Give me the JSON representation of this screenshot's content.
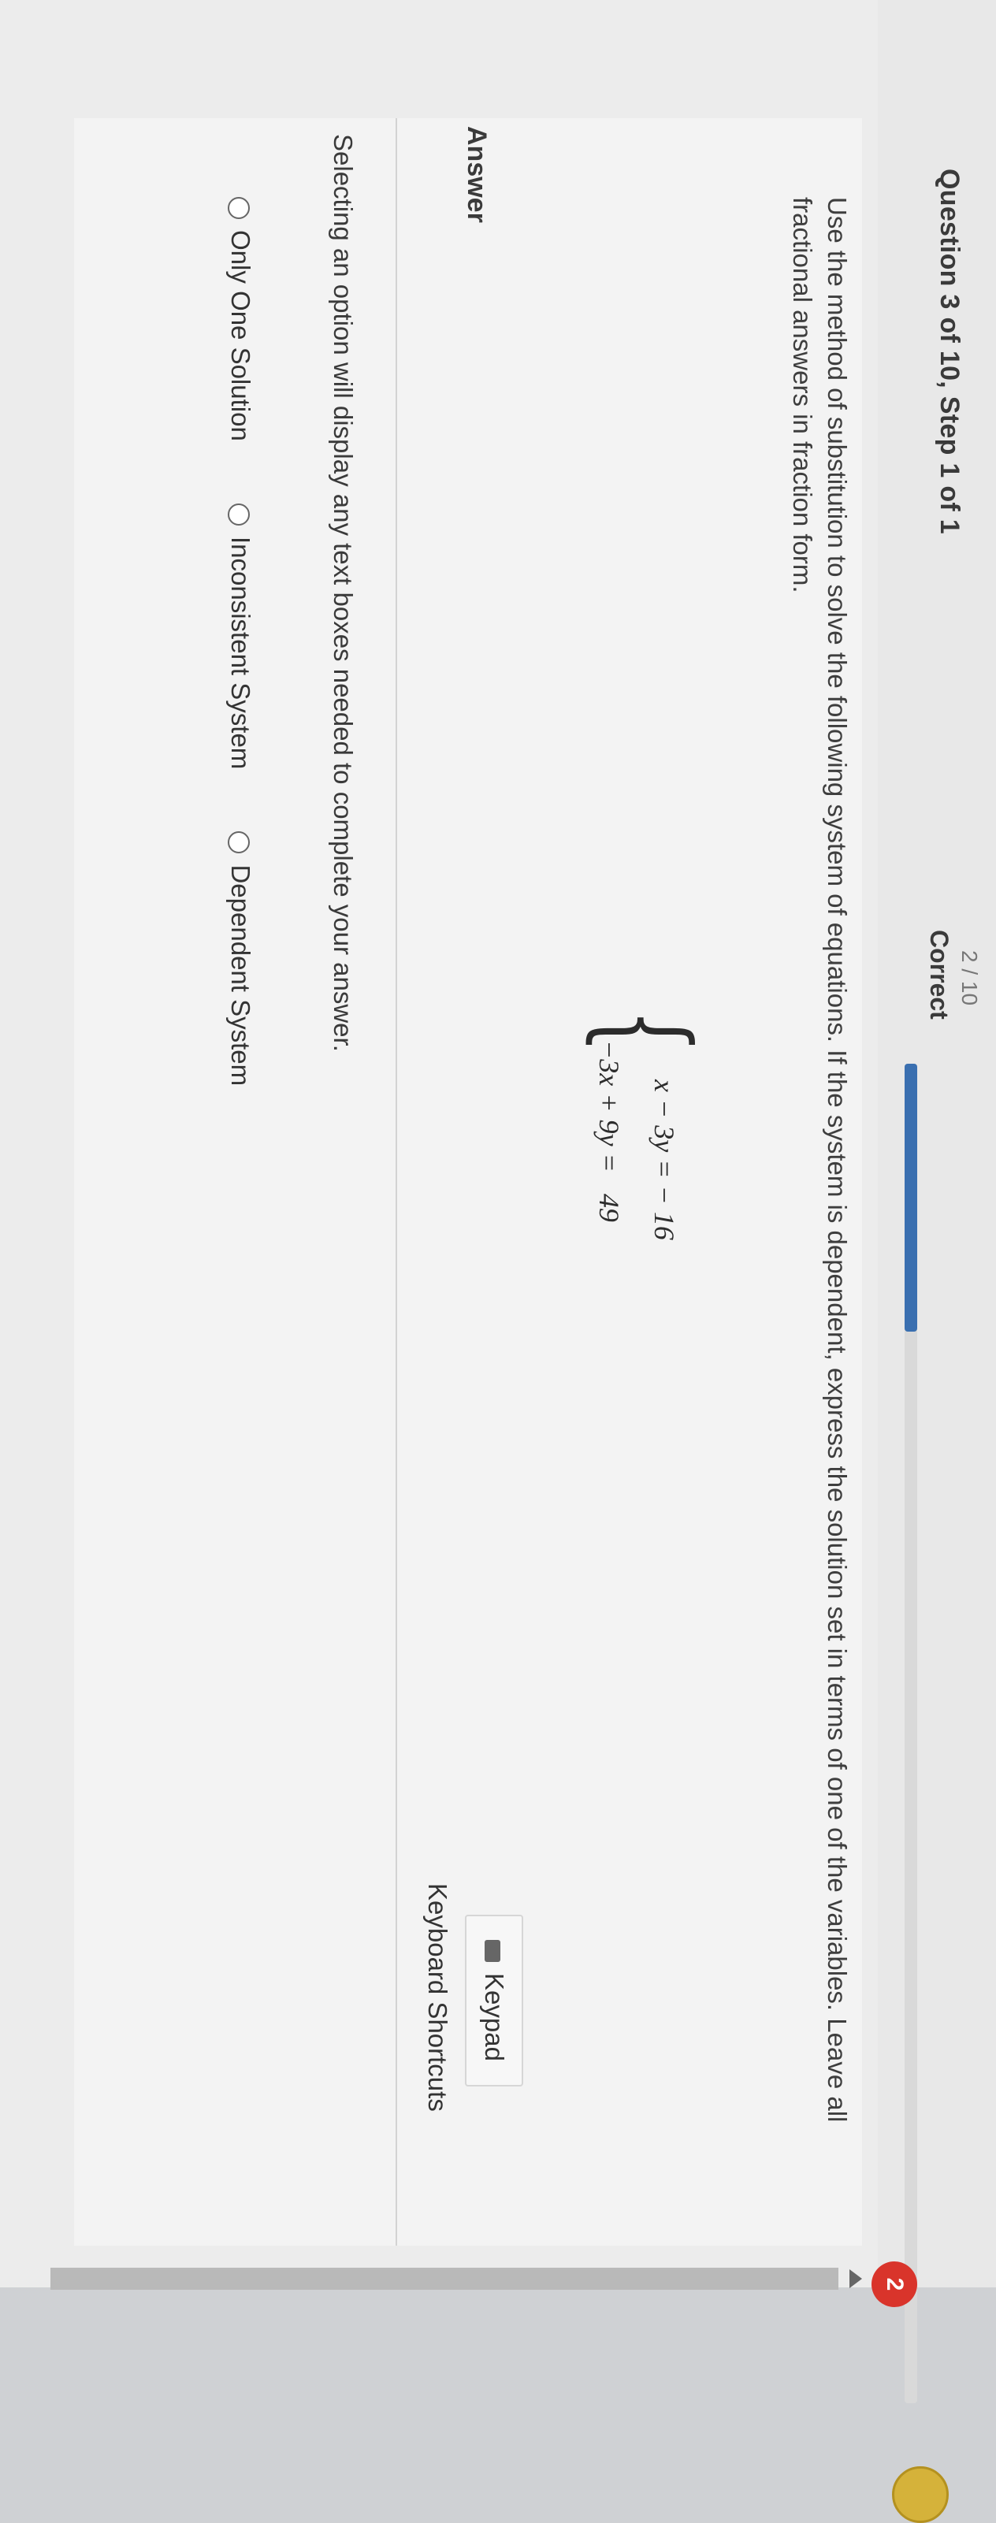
{
  "header": {
    "question_label": "Question 3 of 10, Step 1 of 1",
    "score_fraction": "2 / 10",
    "score_label": "Correct",
    "progress_fraction": 0.2,
    "streak_count": "2"
  },
  "question": {
    "instructions": "Use the method of substitution to solve the following system of equations. If the system is dependent, express the solution set in terms of one of the variables. Leave all fractional answers in fraction form.",
    "brace": "{",
    "equations": [
      "x − 3y = − 16",
      "−3x + 9y =   49"
    ]
  },
  "answer": {
    "heading": "Answer",
    "keypad_label": "Keypad",
    "shortcuts_label": "Keyboard Shortcuts",
    "hint": "Selecting an option will display any text boxes needed to complete your answer.",
    "options": [
      "Only One Solution",
      "Inconsistent System",
      "Dependent System"
    ]
  },
  "colors": {
    "progress_fill": "#3a6fb0",
    "streak_badge": "#d9342b",
    "coin": "#d5b23a"
  },
  "icons": [
    "coin-icon",
    "keypad-icon",
    "scroll-up-icon"
  ]
}
